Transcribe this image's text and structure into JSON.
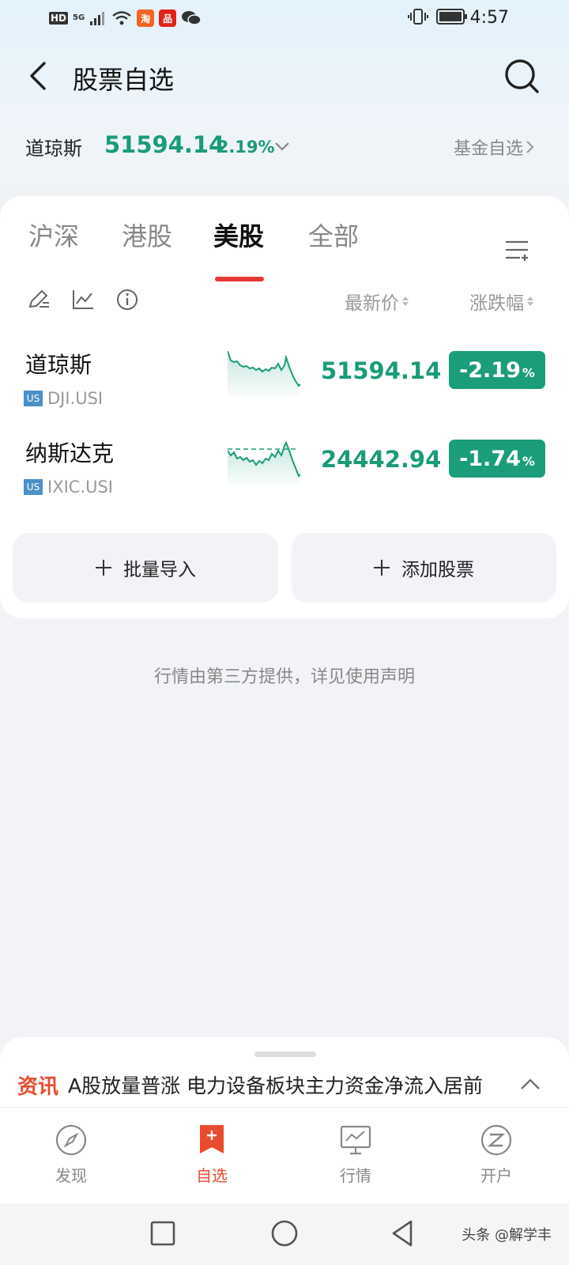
{
  "status_bar": {
    "hd": "HD",
    "network": "5G",
    "app1": "淘",
    "app2": "品",
    "time": "4:57"
  },
  "header": {
    "title": "股票自选"
  },
  "index_bar": {
    "name": "道琼斯",
    "price": "51594.14",
    "change": "-2.19%",
    "fund_link": "基金自选"
  },
  "tabs": [
    {
      "label": "沪深"
    },
    {
      "label": "港股"
    },
    {
      "label": "美股"
    },
    {
      "label": "全部"
    }
  ],
  "active_tab": "美股",
  "columns": {
    "price": "最新价",
    "change": "涨跌幅"
  },
  "stocks": [
    {
      "name": "道琼斯",
      "market": "US",
      "code": "DJI.USI",
      "price": "51594.14",
      "change": "-2.19",
      "pct_sign": "%"
    },
    {
      "name": "纳斯达克",
      "market": "US",
      "code": "IXIC.USI",
      "price": "24442.94",
      "change": "-1.74",
      "pct_sign": "%"
    }
  ],
  "actions": {
    "import": "批量导入",
    "add": "添加股票"
  },
  "disclaimer": "行情由第三方提供，详见使用声明",
  "news": {
    "tag": "资讯",
    "headline": "A股放量普涨 电力设备板块主力资金净流入居前"
  },
  "bottom_nav": [
    {
      "label": "发现"
    },
    {
      "label": "自选"
    },
    {
      "label": "行情"
    },
    {
      "label": "开户"
    }
  ],
  "watermark": "头条 @解学丰",
  "colors": {
    "down_green": "#1b9c7a",
    "accent_red": "#e53935",
    "news_orange": "#e84c2e"
  }
}
